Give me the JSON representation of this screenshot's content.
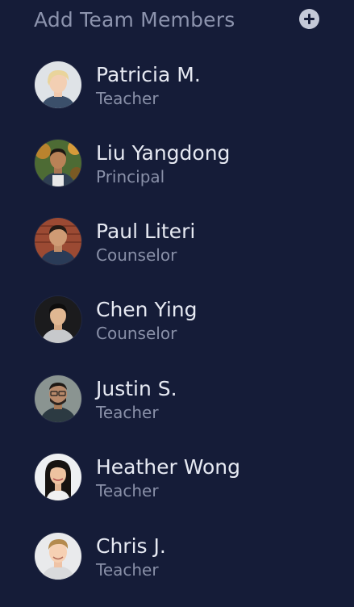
{
  "header": {
    "title": "Add Team Members",
    "add_icon": "plus-circle-icon"
  },
  "members": [
    {
      "name": "Patricia M.",
      "role": "Teacher"
    },
    {
      "name": "Liu Yangdong",
      "role": "Principal"
    },
    {
      "name": "Paul Literi",
      "role": "Counselor"
    },
    {
      "name": "Chen Ying",
      "role": "Counselor"
    },
    {
      "name": "Justin S.",
      "role": "Teacher"
    },
    {
      "name": "Heather Wong",
      "role": "Teacher"
    },
    {
      "name": "Chris J.",
      "role": "Teacher"
    }
  ],
  "colors": {
    "background": "#151c38",
    "title": "#8c93ad",
    "name": "#e6e9f2",
    "role": "#8990a8"
  }
}
